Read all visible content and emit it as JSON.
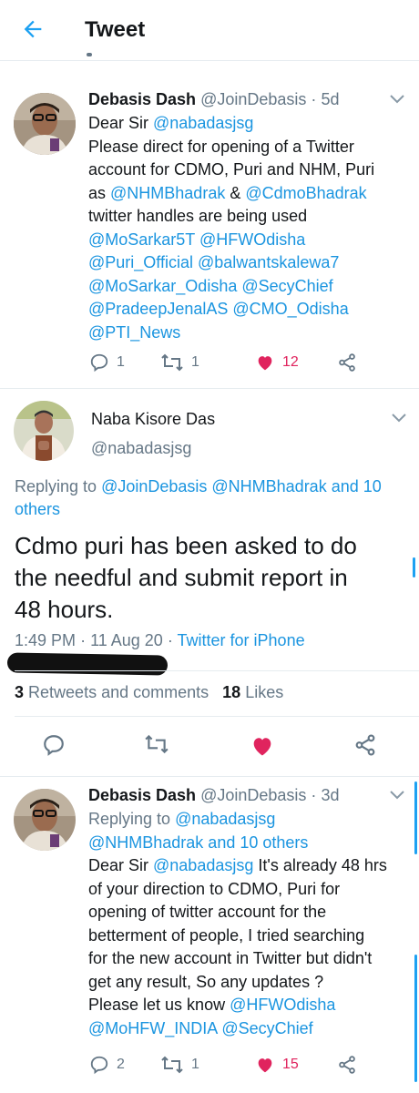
{
  "header": {
    "title": "Tweet"
  },
  "reply1": {
    "name": "Debasis Dash",
    "handle": "@JoinDebasis",
    "dot": "·",
    "time": "5d",
    "lines": [
      [
        {
          "t": "Dear Sir ",
          "c": ""
        },
        {
          "t": "@nabadasjsg",
          "c": "link"
        }
      ],
      [
        {
          "t": "Please direct for opening of a Twitter",
          "c": ""
        }
      ],
      [
        {
          "t": "account for CDMO, Puri and NHM, Puri",
          "c": ""
        }
      ],
      [
        {
          "t": "as ",
          "c": ""
        },
        {
          "t": "@NHMBhadrak",
          "c": "link"
        },
        {
          "t": " & ",
          "c": ""
        },
        {
          "t": "@CdmoBhadrak",
          "c": "link"
        }
      ],
      [
        {
          "t": "twitter handles are being used",
          "c": ""
        }
      ],
      [
        {
          "t": "@MoSarkar5T",
          "c": "link"
        },
        {
          "t": " ",
          "c": ""
        },
        {
          "t": "@HFWOdisha",
          "c": "link"
        }
      ],
      [
        {
          "t": "@Puri_Official",
          "c": "link"
        },
        {
          "t": " ",
          "c": ""
        },
        {
          "t": "@balwantskalewa7",
          "c": "link"
        }
      ],
      [
        {
          "t": "@MoSarkar_Odisha",
          "c": "link"
        },
        {
          "t": " ",
          "c": ""
        },
        {
          "t": "@SecyChief",
          "c": "link"
        }
      ],
      [
        {
          "t": "@PradeepJenalAS",
          "c": "link"
        },
        {
          "t": " ",
          "c": ""
        },
        {
          "t": "@CMO_Odisha",
          "c": "link"
        }
      ],
      [
        {
          "t": "@PTI_News",
          "c": "link"
        }
      ]
    ],
    "replies": "1",
    "retweets": "1",
    "likes": "12"
  },
  "main": {
    "name": "Naba Kisore Das",
    "handle": "@nabadasjsg",
    "replying_prefix": "Replying to ",
    "replying_line1": "@JoinDebasis @NHMBhadrak and 10",
    "replying_line2": "others",
    "text_lines": [
      "Cdmo puri has been asked to do",
      "the needful and submit report in",
      "48 hours."
    ],
    "time": "1:49 PM",
    "date": "11 Aug 20",
    "dot": "·",
    "source": "Twitter for iPhone",
    "retweets_count": "3",
    "retweets_label": "Retweets and comments",
    "likes_count": "18",
    "likes_label": "Likes"
  },
  "reply2": {
    "name": "Debasis Dash",
    "handle": "@JoinDebasis",
    "dot": "·",
    "time": "3d",
    "lines": [
      [
        {
          "t": "Replying to ",
          "c": "muted"
        },
        {
          "t": "@nabadasjsg",
          "c": "link"
        }
      ],
      [
        {
          "t": "@NHMBhadrak and 10 others",
          "c": "link"
        }
      ],
      [
        {
          "t": "Dear Sir ",
          "c": ""
        },
        {
          "t": "@nabadasjsg",
          "c": "link"
        },
        {
          "t": " It's already 48 hrs",
          "c": ""
        }
      ],
      [
        {
          "t": "of your direction to CDMO, Puri for",
          "c": ""
        }
      ],
      [
        {
          "t": "opening of twitter account for the",
          "c": ""
        }
      ],
      [
        {
          "t": "betterment of people, I tried searching",
          "c": ""
        }
      ],
      [
        {
          "t": "for the new account in Twitter but didn't",
          "c": ""
        }
      ],
      [
        {
          "t": "get any result, So any updates ?",
          "c": ""
        }
      ],
      [
        {
          "t": "Please let us know ",
          "c": ""
        },
        {
          "t": "@HFWOdisha",
          "c": "link"
        }
      ],
      [
        {
          "t": "@MoHFW_INDIA",
          "c": "link"
        },
        {
          "t": " ",
          "c": ""
        },
        {
          "t": "@SecyChief",
          "c": "link"
        }
      ]
    ],
    "replies": "2",
    "retweets": "1",
    "likes": "15"
  },
  "colors": {
    "accent": "#1da1f2",
    "link": "#1b95e0",
    "like": "#e0245e",
    "muted": "#657786"
  }
}
